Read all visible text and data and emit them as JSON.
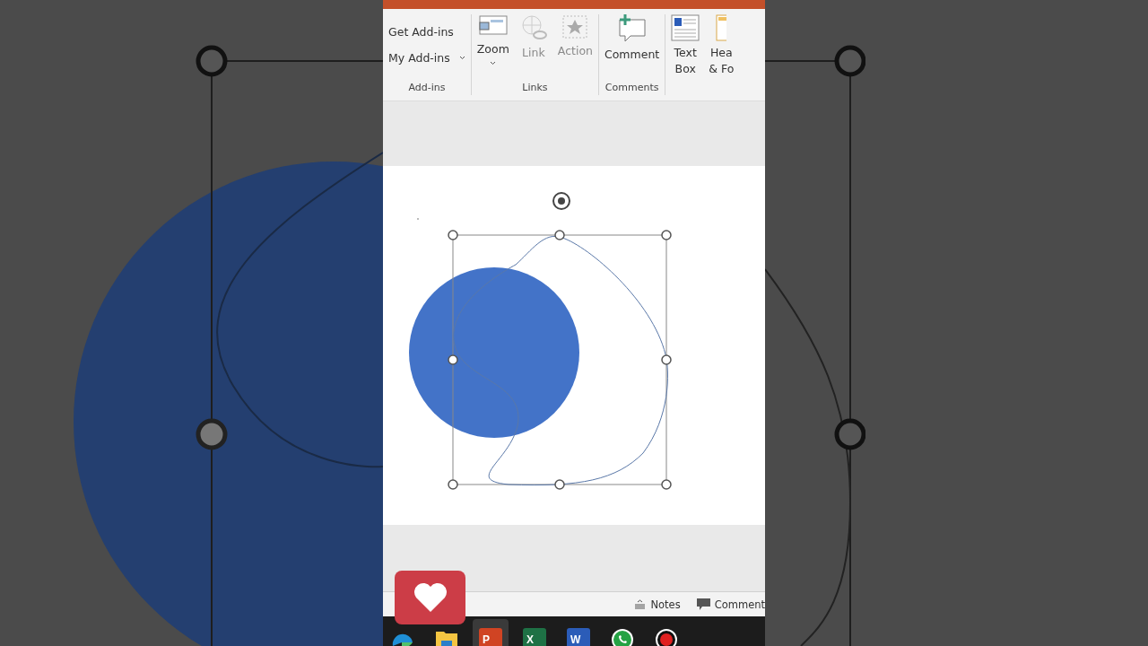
{
  "ribbon": {
    "groups": [
      {
        "label": "Add-ins",
        "kind": "list",
        "buttons": [
          {
            "label": "Get Add-ins",
            "caret": false
          },
          {
            "label": "My Add-ins",
            "caret": true
          }
        ]
      },
      {
        "label": "Links",
        "kind": "large",
        "buttons": [
          {
            "label": "Zoom",
            "kind": "zoom",
            "disabled": false,
            "caret": true
          },
          {
            "label": "Link",
            "kind": "link",
            "disabled": true,
            "caret": false
          },
          {
            "label": "Action",
            "kind": "action",
            "disabled": true,
            "caret": false
          }
        ]
      },
      {
        "label": "Comments",
        "kind": "large",
        "buttons": [
          {
            "label": "Comment",
            "kind": "comment",
            "disabled": false,
            "caret": false
          }
        ]
      },
      {
        "kind": "large",
        "buttons": [
          {
            "label": "Text\nBox",
            "kind": "textbox",
            "disabled": false,
            "caret": false
          },
          {
            "label": "Hea\n& Fo",
            "kind": "header",
            "disabled": false,
            "caret": false
          }
        ]
      }
    ]
  },
  "status_bar": {
    "items": [
      {
        "label": "Notes",
        "kind": "notes"
      },
      {
        "label": "Comment",
        "kind": "comments"
      }
    ]
  },
  "taskbar": {
    "apps": [
      {
        "kind": "edge",
        "selected": false
      },
      {
        "kind": "folder",
        "selected": false
      },
      {
        "kind": "office",
        "label": "P",
        "color": "#d04423",
        "selected": true
      },
      {
        "kind": "office",
        "label": "X",
        "color": "#1e7145",
        "selected": false
      },
      {
        "kind": "office",
        "label": "W",
        "color": "#2b5cb8",
        "selected": false
      },
      {
        "kind": "chat",
        "selected": false
      },
      {
        "kind": "record",
        "selected": false
      }
    ]
  }
}
